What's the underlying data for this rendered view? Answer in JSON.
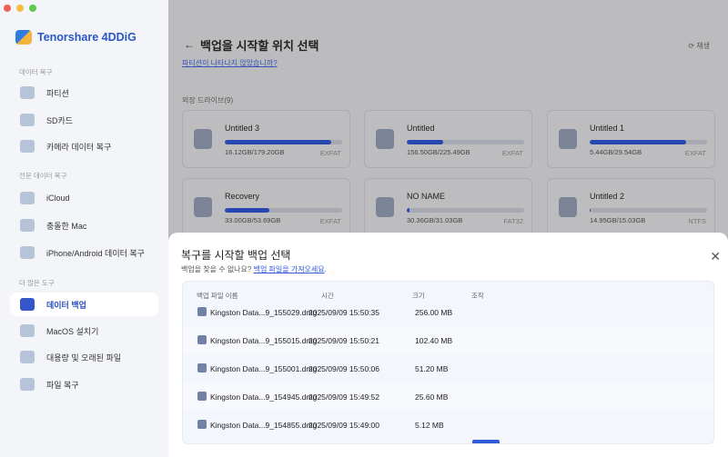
{
  "window": {
    "controls": [
      "close",
      "minimize",
      "maximize"
    ],
    "colors": [
      "#ee5f57",
      "#f6bd3f",
      "#5fc84d"
    ]
  },
  "app": {
    "name": "Tenorshare 4DDiG"
  },
  "sidebar": {
    "sections": [
      {
        "title": "데이터 복구",
        "items": [
          {
            "label": "파티션",
            "icon": "partition-icon"
          },
          {
            "label": "SD카드",
            "icon": "sd-card-icon"
          },
          {
            "label": "카메라 데이터 복구",
            "icon": "camera-icon"
          }
        ]
      },
      {
        "title": "전문 데이터 복구",
        "items": [
          {
            "label": "iCloud",
            "icon": "cloud-icon"
          },
          {
            "label": "충돌한 Mac",
            "icon": "crashed-mac-icon"
          },
          {
            "label": "iPhone/Android 데이터 복구",
            "icon": "phone-recovery-icon"
          }
        ]
      },
      {
        "title": "더 많은 도구",
        "items": [
          {
            "label": "데이터 백업",
            "icon": "backup-icon",
            "active": true
          },
          {
            "label": "MacOS 설치기",
            "icon": "apple-icon"
          },
          {
            "label": "대용량 및 오래된 파일",
            "icon": "file-icon"
          },
          {
            "label": "파일 복구",
            "icon": "file-repair-icon"
          }
        ]
      }
    ]
  },
  "main": {
    "back": "←",
    "title": "백업을 시작할 위치 선택",
    "partition_link": "파티션이 나타나지 않았습니까?",
    "refresh": "재생",
    "drives_label": "외장 드라이브(9)",
    "drives": [
      {
        "name": "Untitled 3",
        "size": "16.12GB/179.20GB",
        "fs": "EXFAT",
        "usage_fraction": 0.91
      },
      {
        "name": "Untitled",
        "size": "156.50GB/225.49GB",
        "fs": "EXFAT",
        "usage_fraction": 0.31
      },
      {
        "name": "Untitled 1",
        "size": "5.44GB/29.54GB",
        "fs": "EXFAT",
        "usage_fraction": 0.82
      },
      {
        "name": "Recovery",
        "size": "33.00GB/53.69GB",
        "fs": "EXFAT",
        "usage_fraction": 0.38
      },
      {
        "name": "NO NAME",
        "size": "30.36GB/31.03GB",
        "fs": "FAT32",
        "usage_fraction": 0.02
      },
      {
        "name": "Untitled 2",
        "size": "14.95GB/15.03GB",
        "fs": "NTFS",
        "usage_fraction": 0.01
      }
    ]
  },
  "modal": {
    "title": "복구를 시작할 백업 선택",
    "subtitle": "백업을 찾을 수 없나요?",
    "import_link": "백업 파일을 가져오세요",
    "period": ".",
    "close": "✕",
    "columns": [
      "백업 파일 이름",
      "시간",
      "크기",
      "조작"
    ],
    "rows": [
      {
        "name": "Kingston Data...9_155029.dmg",
        "time": "2025/09/09 15:50:35",
        "size": "256.00 MB"
      },
      {
        "name": "Kingston Data...9_155015.dmg",
        "time": "2025/09/09 15:50:21",
        "size": "102.40 MB"
      },
      {
        "name": "Kingston Data...9_155001.dmg",
        "time": "2025/09/09 15:50:06",
        "size": "51.20 MB"
      },
      {
        "name": "Kingston Data...9_154945.dmg",
        "time": "2025/09/09 15:49:52",
        "size": "25.60 MB"
      },
      {
        "name": "Kingston Data...9_154855.dmg",
        "time": "2025/09/09 15:49:00",
        "size": "5.12 MB"
      }
    ]
  }
}
